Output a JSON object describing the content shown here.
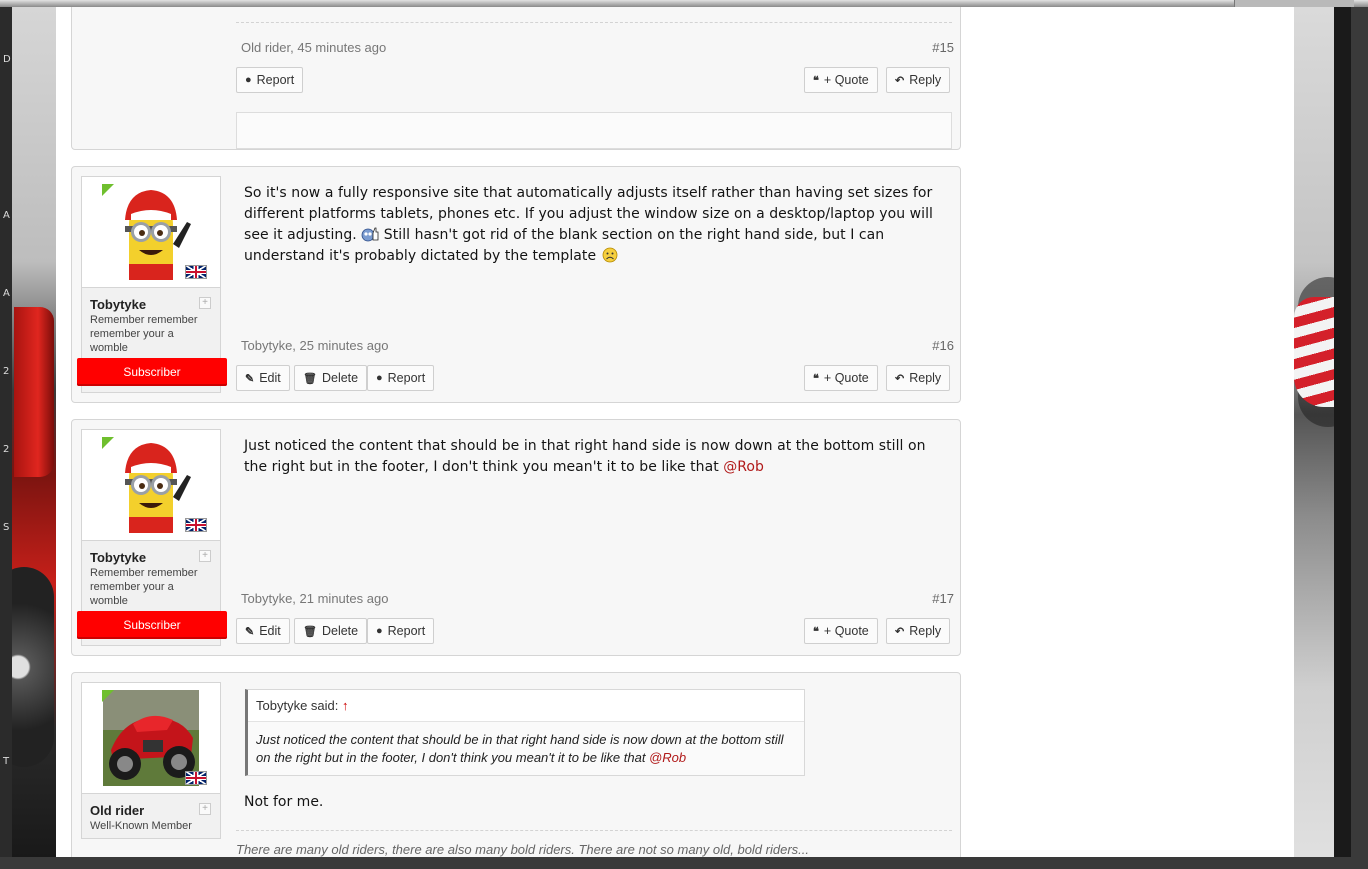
{
  "sidebar_edge_letters": [
    "D",
    "A",
    "A",
    "2",
    "2",
    "S",
    "T"
  ],
  "posts": [
    {
      "id": "p15",
      "meta": {
        "author": "Old rider",
        "time": "45 minutes ago",
        "author_time": "Old rider, 45 minutes ago",
        "number": "#15"
      },
      "buttons": {
        "report": "Report",
        "quote": "+ Quote",
        "reply": "Reply"
      }
    },
    {
      "id": "p16",
      "user": {
        "name": "Tobytyke",
        "title": "Remember remember remember your a womble",
        "badge": "Subscriber",
        "avatar_icon": "minion-ducati-cap-avatar",
        "flag_icon": "uk-flag-icon"
      },
      "message": {
        "part1": "So it's now a fully responsive site that automatically adjusts itself rather than having set sizes for different platforms tablets, phones etc. If you adjust the window size on a desktop/laptop you will see it adjusting.",
        "part2": " Still hasn't got rid of the blank section on the right hand side, but I can understand it's probably dictated by the template ",
        "smiley1": "thumbs-up-smiley-icon",
        "smiley2": "sad-smiley-icon"
      },
      "meta": {
        "author_time": "Tobytyke, 25 minutes ago",
        "number": "#16"
      },
      "buttons": {
        "edit": "Edit",
        "delete": "Delete",
        "report": "Report",
        "quote": "+ Quote",
        "reply": "Reply"
      }
    },
    {
      "id": "p17",
      "user": {
        "name": "Tobytyke",
        "title": "Remember remember remember your a womble",
        "badge": "Subscriber"
      },
      "message": {
        "text": "Just noticed the content that should be in that right hand side is now down at the bottom still on the right but in the footer, I don't think you mean't it to be like that ",
        "mention": "@Rob"
      },
      "meta": {
        "author_time": "Tobytyke, 21 minutes ago",
        "number": "#17"
      },
      "buttons": {
        "edit": "Edit",
        "delete": "Delete",
        "report": "Report",
        "quote": "+ Quote",
        "reply": "Reply"
      }
    },
    {
      "id": "p18",
      "user": {
        "name": "Old rider",
        "title": "Well-Known Member",
        "avatar_icon": "red-ducati-motorcycle-avatar"
      },
      "quote": {
        "author_said": "Tobytyke said:",
        "arrow": "↑",
        "text": "Just noticed the content that should be in that right hand side is now down at the bottom still on the right but in the footer, I don't think you mean't it to be like that ",
        "mention": "@Rob"
      },
      "reply": "Not for me.",
      "signature": "There are many old riders, there are also many bold riders. There are not so many old, bold riders..."
    }
  ],
  "icons": {
    "report": "exclamation-circle-icon",
    "quote": "quote-icon",
    "reply": "reply-arrow-icon",
    "edit": "pencil-icon",
    "delete": "trash-icon",
    "expand": "plus-box-icon"
  },
  "colors": {
    "badge": "#ff0000",
    "mention": "#b11a1a",
    "online": "#6fbf2e"
  }
}
